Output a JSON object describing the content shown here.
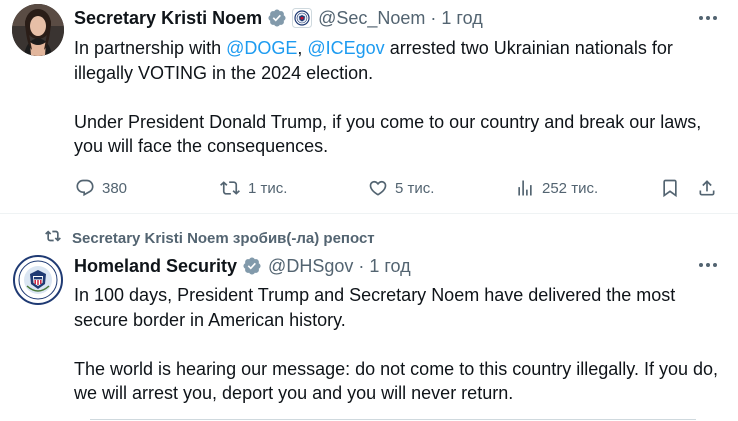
{
  "tweet1": {
    "name": "Secretary Kristi Noem",
    "handle": "@Sec_Noem",
    "dot": "·",
    "time": "1 год",
    "text1": {
      "before": "In partnership with ",
      "mention1": "@DOGE",
      "sep": ", ",
      "mention2": "@ICEgov",
      "after": " arrested two Ukrainian nationals for illegally VOTING in the 2024 election."
    },
    "text2": "Under President Donald Trump, if you come to our country and break our laws, you will face the consequences.",
    "actions": {
      "replies": "380",
      "reposts": "1 тис.",
      "likes": "5 тис.",
      "views": "252 тис."
    },
    "icons": [
      "verified-badge-icon",
      "dhs-affiliate-badge-icon",
      "more-icon",
      "reply-icon",
      "repost-icon",
      "like-icon",
      "views-icon",
      "bookmark-icon",
      "share-icon"
    ]
  },
  "repost_context": "Secretary Kristi Noem зробив(-ла) репост",
  "tweet2": {
    "name": "Homeland Security",
    "handle": "@DHSgov",
    "dot": "·",
    "time": "1 год",
    "text1": "In 100 days, President Trump and Secretary Noem have delivered the most secure border in American history.",
    "text2": "The world is hearing our message: do not come to this country illegally. If you do, we will arrest you, deport you and you will never return.",
    "icons": [
      "gray-verified-badge-icon",
      "more-icon"
    ]
  },
  "colors": {
    "accent": "#1d9bf0",
    "secondary_text": "#536471",
    "primary_text": "#0f1419",
    "government_badge": "#829aab"
  }
}
